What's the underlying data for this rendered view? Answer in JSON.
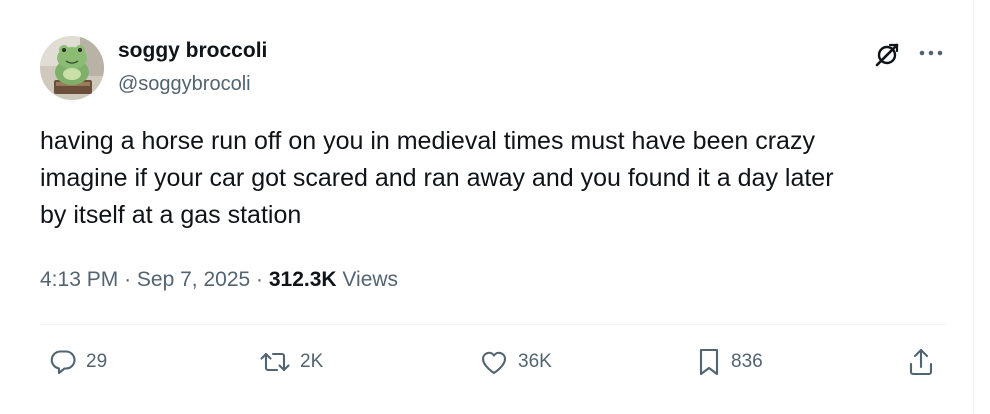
{
  "author": {
    "display_name": "soggy broccoli",
    "handle": "@soggybrocoli"
  },
  "tweet": {
    "lines": [
      "having a horse run off on you in medieval times must have been crazy",
      "imagine if your car got scared and ran away and you found it a day later",
      "by itself at a gas station"
    ]
  },
  "meta": {
    "time": "4:13 PM",
    "sep1": "·",
    "date": "Sep 7, 2025",
    "sep2": "·",
    "views_count": "312.3K",
    "views_label": "Views"
  },
  "actions": {
    "replies": "29",
    "reposts": "2K",
    "likes": "36K",
    "bookmarks": "836"
  },
  "icons": {
    "grok": "grok-icon",
    "more": "more-icon",
    "reply": "reply-icon",
    "repost": "repost-icon",
    "like": "heart-icon",
    "bookmark": "bookmark-icon",
    "share": "share-icon"
  },
  "colors": {
    "text_primary": "#0f1419",
    "text_secondary": "#536471",
    "divider": "#eff3f4"
  }
}
